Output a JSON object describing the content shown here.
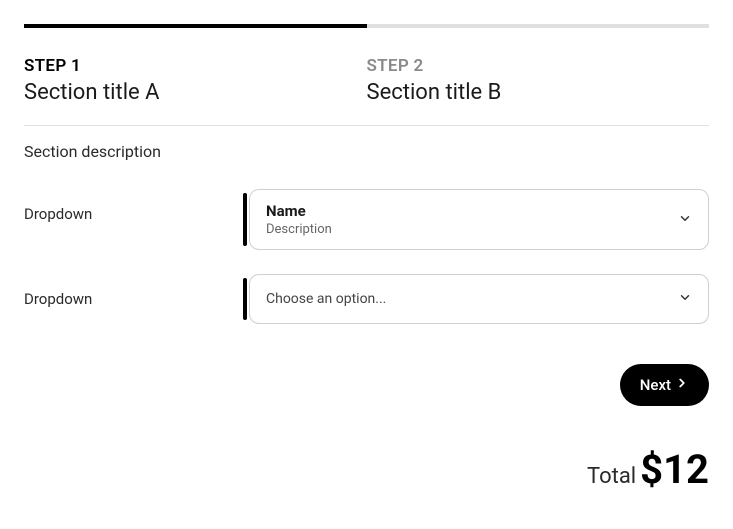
{
  "steps": [
    {
      "number": "STEP 1",
      "title": "Section title A",
      "active": true
    },
    {
      "number": "STEP 2",
      "title": "Section title B",
      "active": false
    }
  ],
  "section_description": "Section description",
  "fields": [
    {
      "label": "Dropdown",
      "selected_name": "Name",
      "selected_desc": "Description"
    },
    {
      "label": "Dropdown",
      "placeholder": "Choose an option..."
    }
  ],
  "next_label": "Next",
  "total": {
    "label": "Total",
    "value": "$12"
  }
}
